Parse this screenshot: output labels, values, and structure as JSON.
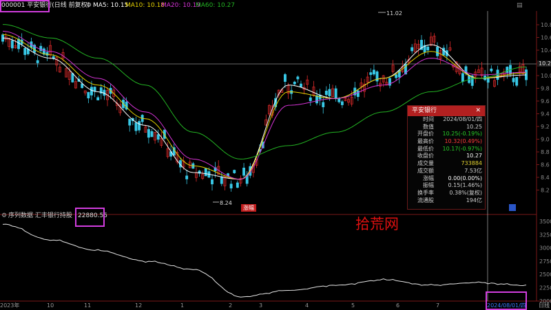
{
  "header": {
    "stock_title": "000001 平安银行(日线 前复权)",
    "ma_icon": "gear-icon",
    "ma5": "MA5: 10.15",
    "ma10": "MA10: 10.18",
    "ma20": "MA20: 10.19",
    "ma60": "MA60: 10.27",
    "colors": {
      "ma5": "#ffffff",
      "ma10": "#e6d200",
      "ma20": "#d633d6",
      "ma60": "#23b523",
      "up": "#e22b2b",
      "down": "#38c8e6"
    }
  },
  "price_axis": [
    "10.8",
    "10.6",
    "10.4",
    "10.2",
    "10.0",
    "9.8",
    "9.6",
    "9.4",
    "9.2",
    "9.0",
    "8.8",
    "8.6",
    "8.4",
    "8.2"
  ],
  "current_price_tag": "10.25",
  "chart_markers": {
    "high": "11.02",
    "low": "8.24",
    "event_label": "涨幅"
  },
  "info_panel": {
    "title": "平安银行",
    "rows": [
      {
        "k": "时间",
        "v": "2024/08/01/四",
        "color": "#d0d0d0"
      },
      {
        "k": "数值",
        "v": "10.25",
        "color": "#d0d0d0"
      },
      {
        "k": "开盘价",
        "v": "10.25(-0.19%)",
        "color": "#28d028"
      },
      {
        "k": "最高价",
        "v": "10.32(0.49%)",
        "color": "#ff3b3b"
      },
      {
        "k": "最低价",
        "v": "10.17(-0.97%)",
        "color": "#28d028"
      },
      {
        "k": "收盘价",
        "v": "10.27",
        "color": "#ffffff"
      },
      {
        "k": "成交量",
        "v": "733884",
        "color": "#e0d030"
      },
      {
        "k": "成交额",
        "v": "7.53亿",
        "color": "#d0d0d0"
      },
      {
        "k": "涨幅",
        "v": "0.00(0.00%)",
        "color": "#ffffff"
      },
      {
        "k": "振幅",
        "v": "0.15(1.46%)",
        "color": "#d0d0d0"
      },
      {
        "k": "换手率",
        "v": "0.38%(复权)",
        "color": "#d0d0d0"
      },
      {
        "k": "流通股",
        "v": "194亿",
        "color": "#d0d0d0"
      }
    ]
  },
  "lower": {
    "title": "序列数据  汇丰银行持股",
    "value": "22880.55",
    "axis": [
      "3500",
      "3250",
      "3000",
      "2750",
      "2500",
      "2250",
      "2000"
    ],
    "watermark": "拾荒网"
  },
  "bottom_axis": {
    "months": [
      "2023年",
      "10",
      "11",
      "12",
      "1",
      "2",
      "3",
      "4",
      "5",
      "6",
      "7"
    ],
    "cursor_date": "2024/08/01/四",
    "right_label": "日线"
  },
  "chart_data": [
    {
      "type": "candlestick",
      "title": "000001 平安银行(日线 前复权)",
      "ylim": [
        8.2,
        11.1
      ],
      "x": [
        "2023-09",
        "2023-10",
        "2023-11",
        "2023-12",
        "2024-01",
        "2024-02",
        "2024-03",
        "2024-04",
        "2024-05",
        "2024-06",
        "2024-07",
        "2024-08"
      ],
      "series": [
        {
          "name": "MA5",
          "values": [
            10.7,
            10.4,
            9.9,
            9.4,
            8.7,
            8.6,
            10.0,
            9.8,
            10.1,
            10.6,
            10.1,
            10.15
          ]
        },
        {
          "name": "MA10",
          "values": [
            10.75,
            10.45,
            10.0,
            9.5,
            8.8,
            8.6,
            9.9,
            9.8,
            10.1,
            10.5,
            10.1,
            10.18
          ]
        },
        {
          "name": "MA20",
          "values": [
            10.8,
            10.5,
            10.1,
            9.6,
            8.9,
            8.6,
            9.7,
            9.8,
            10.0,
            10.4,
            10.15,
            10.19
          ]
        },
        {
          "name": "MA60",
          "values": [
            10.9,
            10.7,
            10.4,
            10.0,
            9.3,
            8.9,
            9.1,
            9.3,
            9.6,
            9.9,
            10.1,
            10.27
          ]
        }
      ],
      "annotations": [
        "11.02",
        "8.24"
      ]
    },
    {
      "type": "line",
      "title": "序列数据  汇丰银行持股",
      "ylim": [
        2000,
        3500
      ],
      "x": [
        "2023-09",
        "2023-10",
        "2023-11",
        "2023-12",
        "2024-01",
        "2024-02",
        "2024-03",
        "2024-04",
        "2024-05",
        "2024-06",
        "2024-07",
        "2024-08"
      ],
      "values": [
        3450,
        3150,
        2950,
        2750,
        2600,
        2080,
        2200,
        2300,
        2400,
        2300,
        2350,
        2290
      ]
    }
  ]
}
